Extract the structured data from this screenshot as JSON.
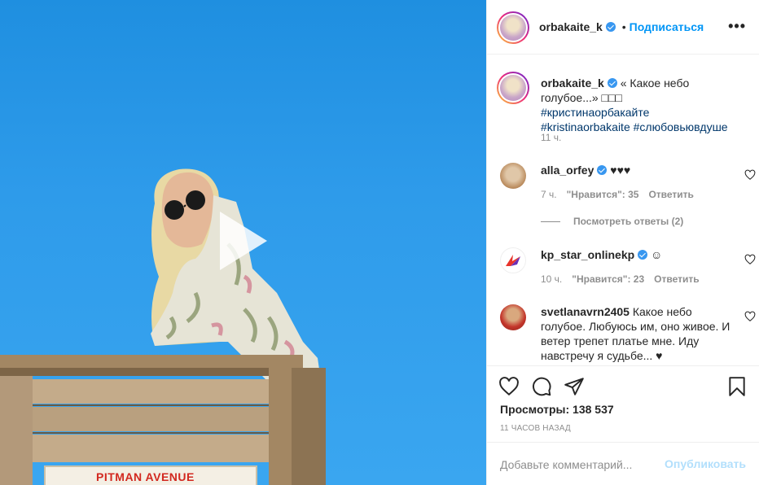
{
  "colors": {
    "link": "#0095f6",
    "hashtag": "#00376b",
    "muted": "#8e8e8e",
    "publish_disabled": "#b2dffc"
  },
  "media": {
    "sign_text": "PITMAN AVENUE",
    "play_icon": "play-icon"
  },
  "header": {
    "username": "orbakaite_k",
    "separator": "•",
    "follow_label": "Подписаться",
    "more_label": "•••"
  },
  "caption": {
    "username": "orbakaite_k",
    "text_before": " « Какое небо голубое...» □□□ ",
    "hashtag1": "#кристинаорбакайте",
    "hashtag2": "#kristinaorbakaite",
    "hashtag3": "#слюбовьювдуше",
    "time": "11 ч."
  },
  "comments": [
    {
      "username": "alla_orfey",
      "text": " ♥♥♥",
      "time": "7 ч.",
      "likes": "\"Нравится\": 35",
      "reply": "Ответить",
      "view_replies": "Посмотреть ответы (2)"
    },
    {
      "username": "kp_star_onlinekp",
      "text": " ☺",
      "time": "10 ч.",
      "likes": "\"Нравится\": 23",
      "reply": "Ответить"
    },
    {
      "username": "svetlanavrn2405",
      "text": " Какое небо голубое. Любуюсь им, оно живое. И ветер трепет платье мне. Иду навстречу я судьбе... ♥"
    }
  ],
  "actions": {
    "views": "Просмотры: 138 537",
    "time_ago": "11 ЧАСОВ НАЗАД"
  },
  "add_comment": {
    "placeholder": "Добавьте комментарий...",
    "publish_label": "Опубликовать"
  }
}
